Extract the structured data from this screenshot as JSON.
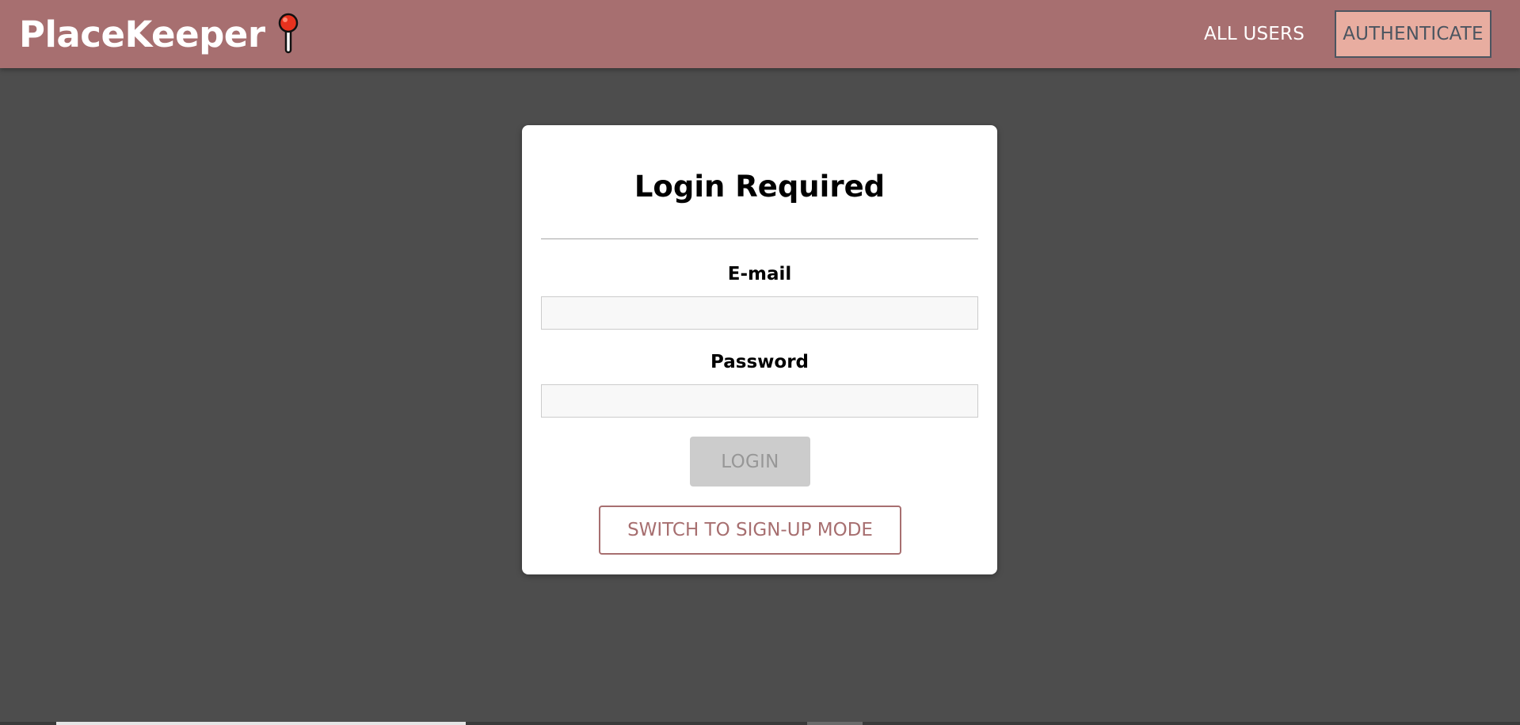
{
  "header": {
    "brand": "PlaceKeeper",
    "brand_icon": "pushpin-icon",
    "nav": {
      "all_users": "ALL USERS",
      "authenticate": "AUTHENTICATE"
    }
  },
  "login": {
    "title": "Login Required",
    "email_label": "E-mail",
    "email_value": "",
    "password_label": "Password",
    "password_value": "",
    "login_button": "LOGIN",
    "switch_button": "SWITCH TO SIGN-UP MODE"
  },
  "colors": {
    "header_bg": "#a76f70",
    "page_bg": "#4d4d4d",
    "active_nav_bg": "#e8ada0",
    "accent": "#a76f70",
    "disabled_button": "#cccccc"
  }
}
